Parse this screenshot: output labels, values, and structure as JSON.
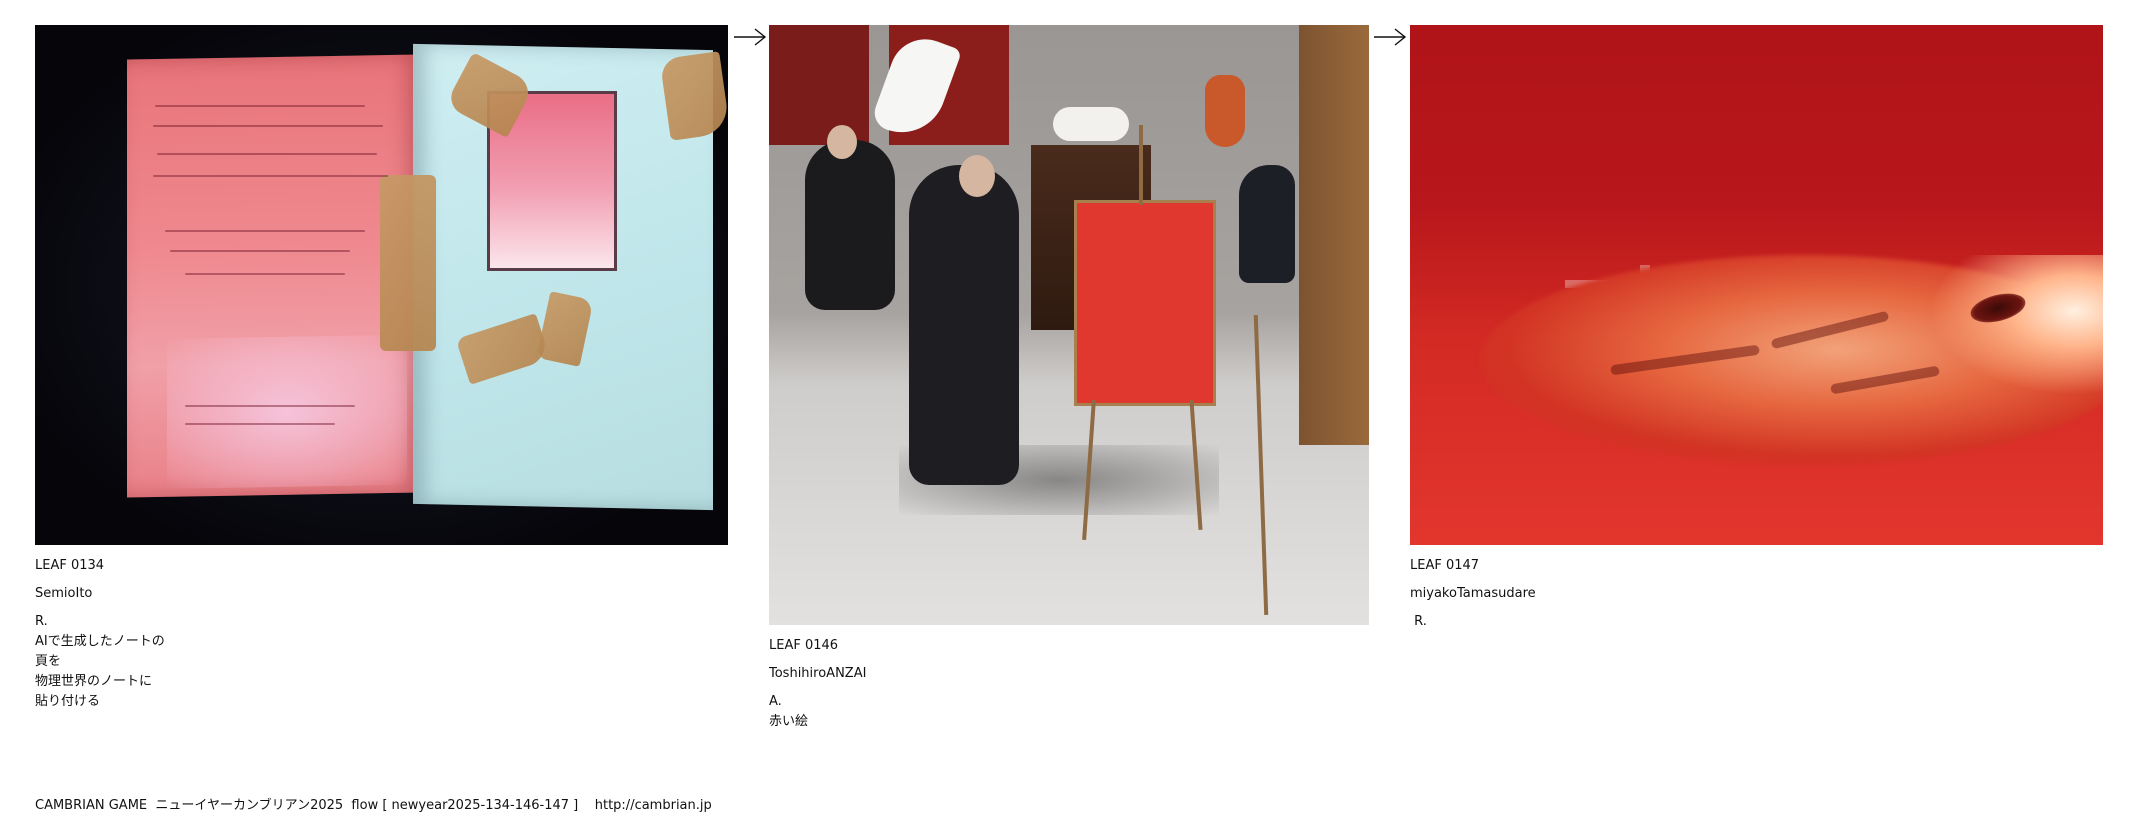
{
  "leaves": [
    {
      "id": "LEAF 0134",
      "author": "SemioIto",
      "type": "R.",
      "lines": [
        "AIで生成したノートの",
        "頁を",
        "物理世界のノートに",
        "貼り付ける"
      ]
    },
    {
      "id": "LEAF 0146",
      "author": "ToshihiroANZAI",
      "type": "A.",
      "lines": [
        "赤い絵"
      ]
    },
    {
      "id": "LEAF 0147",
      "author": "miyakoTamasudare",
      "type": " R.",
      "lines": []
    }
  ],
  "arrow_icon": "arrow-right-icon",
  "footer": {
    "text": "CAMBRIAN GAME  ニューイヤーカンブリアン2025  flow [ newyear2025-134-146-147 ]    http://cambrian.jp"
  },
  "colors": {
    "background": "#ffffff",
    "text": "#111111",
    "red_canvas": "#e0382e"
  }
}
